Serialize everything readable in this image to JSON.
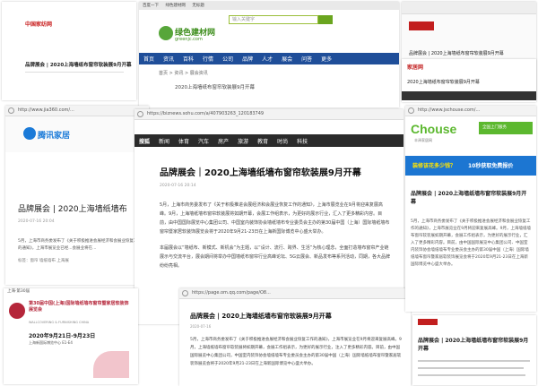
{
  "p1": {
    "logo": "中国家纺网",
    "headline": "品牌展会 | 2020上海墙纸布窗帘软装展9月开幕"
  },
  "p2": {
    "tabs": [
      "百度一下",
      "绿色建材网",
      "无标题"
    ],
    "search_placeholder": "输入关键字",
    "logo_cn": "绿色建材网",
    "logo_en": "greenjc.com",
    "nav": [
      "首页",
      "资讯",
      "百科",
      "行情",
      "公司",
      "品牌",
      "人才",
      "展会",
      "问答",
      "更多"
    ],
    "breadcrumb": "首页 > 资讯 > 展会资讯",
    "subtitle": "2020上海墙纸布窗帘软装展9月开幕"
  },
  "p3": {
    "headline": "品牌展会 | 2020上海墙纸布窗帘软装展9月开幕"
  },
  "p4": {
    "url": "http://www.jia360.com/...",
    "logo": "腾讯家居",
    "headline": "品牌展会 | 2020上海墙纸墙布",
    "meta": "2020-07-16 20:04",
    "body": "5月，上海市商务委发布了《关于积极推进会展经济和会展业恢复工作的通知》，上海市展览业已经...会展业将在...",
    "tags": "标签：窗帘 墙纸墙布 上海展"
  },
  "p5": {
    "url": "https://biznews.sohu.com/a/407903263_120183749",
    "nav": [
      "搜狐",
      "新闻",
      "体育",
      "汽车",
      "房产",
      "旅游",
      "教育",
      "时尚",
      "科技"
    ],
    "headline": "品牌展会｜2020上海墙纸墙布窗帘软装展9月开幕",
    "meta": "2020-07-16 20:14",
    "para1": "5月，上海市商务委发布了《关于积极推进会展经济和会展业恢复工作的通知》，上海市展览业在9月将迎来复展高峰。9月，上海墙纸墙布窗帘软装展将如期开幕，会展工作组表示，为更好的展示行业，汇入了更多精彩内容。目前，由中国国际展览中心集团公司、中国室内装饰协会墙纸墙布专业委员会主办的第30届中国（上海）国际墙纸墙布窗帘暨家居软装饰展览会将于2020年9月21-23日在上海新国际博览中心盛大举办。",
    "para2": "本届展会以“墙纸布、新模式、新机会”为主题，以“设计、流行、跨界、生活”为核心理念，全面打造墙布窗帘产业链展示与交流平台，展会期间将举办中国墙纸布窗帘行业高峰论坛、5G云展会、新品发布等系列活动，同期，各大品牌纷纷亮相。"
  },
  "p6": {
    "tag": "上海·第30届",
    "title": "第30届中国(上海)国际墙纸墙布窗帘暨家居软装饰展览会",
    "subtitle": "WALLCOVERING & FURNISHING CHINA",
    "date": "2020年9月21日-9月23日",
    "venue": "上海新国际博览中心 E1-E4"
  },
  "p7": {
    "url": "https://page.om.qq.com/page/O8...",
    "headline": "品牌展会 | 2020上海墙纸墙布窗帘软装展9月开幕",
    "meta": "2020-07-16",
    "body": "5月，上海市商务委发布了《关于积极推进会展经济和会展业恢复工作的通知》，上海市展览业在9月将迎来复展高峰。9月，上海墙纸墙布窗帘软装展将如期开幕，会展工作组表示，为更好的展示行业，注入了更多精彩内容。目前，由中国国际展览中心集团公司，中国室内装饰协会墙纸墙布专业委员会主办的第30届中国（上海）国际墙纸墙布窗帘暨家居软装饰展览会将于2020年9月21-23日在上海新国际博览中心盛大举办。"
  },
  "p8": {
    "logo": "家居网",
    "headline": "2020上海墙纸布窗帘软装展9月开幕"
  },
  "p9": {
    "url": "http://www.jschouse.com/...",
    "logo": "Chouse",
    "logo_sub": "丰泽家居网",
    "banner_side": "全国上门服务",
    "ad": "装修该花多少钱？",
    "ad_highlight": "10秒获取免费报价",
    "headline": "品牌展会 | 2020上海墙纸墙布窗帘软装展9月开幕",
    "body": "5月，上海市商务委发布了《关于积极推进会展经济和会展业恢复工作的通知》，上海市展览业在9月将迎来复展高峰。9月，上海墙纸墙布窗帘软装展如期开幕，会展工作组表示，为更好的展示行业，汇入了更多精彩内容。目前，由中国国际展览中心集团公司、中国室内装饰协会墙纸墙布专业委员会主办的第30届中国（上海）国际墙纸墙布窗帘暨家居软装饰展览会将于2020年9月21-23日在上海新国际博览中心盛大举办。"
  },
  "p10": {
    "headline": "品牌展会 | 2020上海墙纸墙布窗帘软装展9月开幕"
  },
  "colors": {
    "sohu_nav": "#2b2b2b",
    "green_nav": "#1f4e99",
    "chouse_green": "#5cb82f",
    "ad_blue": "#1c76d2",
    "ad_yellow": "#ffe400",
    "tencent_blue": "#1a7ad8"
  }
}
